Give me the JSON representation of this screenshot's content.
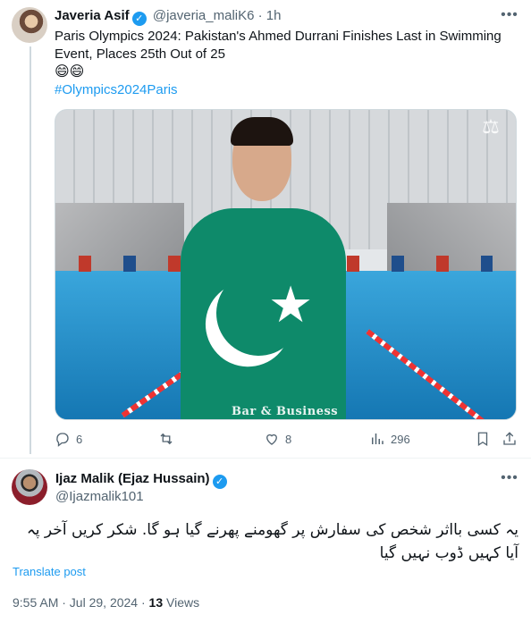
{
  "quoted_tweet": {
    "author_name": "Javeria Asif",
    "verified_badge": "✓",
    "handle": "@javeria_maliK6",
    "separator": "·",
    "time": "1h",
    "more_icon": "more-horizontal-icon",
    "text": "Paris Olympics 2024: Pakistan's Ahmed Durrani Finishes Last in Swimming Event, Places 25th Out of 25",
    "emojis": "😄😄",
    "hashtag": "#Olympics2024Paris",
    "media_watermark": "Bar & Business",
    "actions": {
      "reply_count": "6",
      "retweet_count": "",
      "like_count": "8",
      "views_count": "296"
    }
  },
  "main_tweet": {
    "author_name": "Ijaz Malik (Ejaz Hussain)",
    "verified_badge": "✓",
    "handle": "@Ijazmalik101",
    "more_icon": "more-horizontal-icon",
    "text": "یہ کسی بااثر شخص کی سفارش پر گھومنے پھرنے گیا ہو گا. شکر کریں آخر پہ آیا کہیں ڈوب نہیں گیا",
    "translate_label": "Translate post",
    "timestamp": "9:55 AM · Jul 29, 2024 · ",
    "views_count": "13",
    "views_label": " Views"
  },
  "colors": {
    "accent": "#1d9bf0",
    "secondary_text": "#536471",
    "primary_text": "#0f1419",
    "divider": "#eff3f4"
  }
}
